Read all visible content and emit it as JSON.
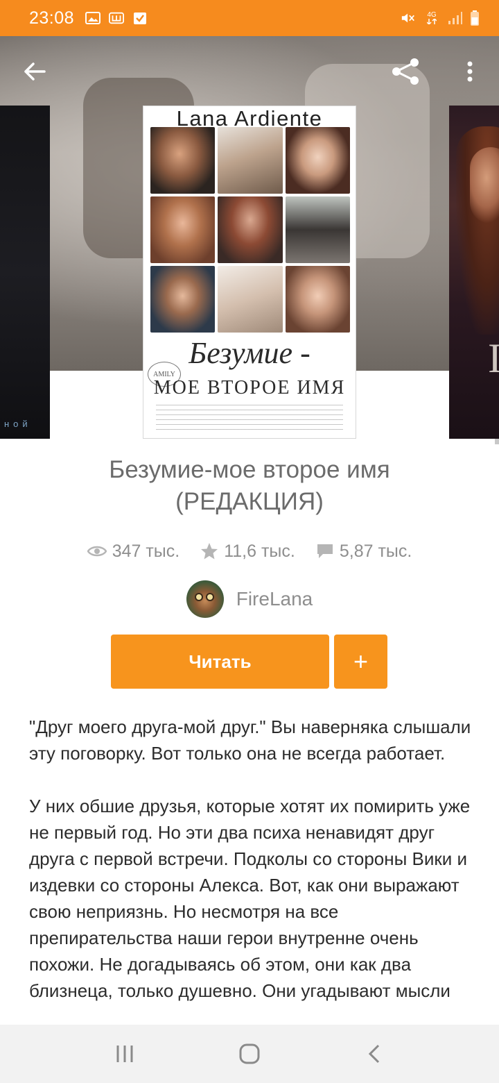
{
  "status_bar": {
    "time": "23:08",
    "left_icons": [
      "image-icon",
      "shop-icon",
      "check-icon"
    ],
    "right_icons": [
      "mute-icon",
      "network-4g-icon",
      "signal-icon",
      "battery-icon"
    ],
    "network_label": "4G"
  },
  "header": {
    "back_icon": "arrow-left-icon",
    "share_icon": "share-icon",
    "more_icon": "more-vert-icon"
  },
  "cover": {
    "author_text": "Lana Ardiente",
    "title_text": "Безумие -",
    "subtitle_text": "МОЕ ВТОРОЕ ИМЯ",
    "stamp_text": "AMILY"
  },
  "book": {
    "title": "Безумие-мое второе имя (РЕДАКЦИЯ)",
    "stats": {
      "reads": "347 тыс.",
      "votes": "11,6 тыс.",
      "comments": "5,87 тыс."
    },
    "author": "FireLana",
    "read_button": "Читать",
    "add_button": "+"
  },
  "description": [
    "\"Друг моего друга-мой друг.\" Вы наверняка слышали эту поговорку. Вот только она не всегда работает.",
    "У них обшие друзья, которые хотят их помирить уже не первый год. Но эти два психа ненавидят друг друга с первой встречи. Подколы со стороны Вики и издевки со стороны Алекса. Вот, как они выражают свою неприязнь. Но несмотря на все препирательства наши герои внутренне очень похожи. Не догадываясь об этом, они как два близнеца, только душевно. Они угадывают мысли"
  ],
  "side_cover_left_text": "ной",
  "colors": {
    "accent": "#f7941d",
    "status_bar": "#f68b1e",
    "muted_text": "#8e8e8e"
  },
  "nav_bar": {
    "recents_icon": "recents-icon",
    "home_icon": "home-icon",
    "back_icon": "nav-back-icon"
  }
}
